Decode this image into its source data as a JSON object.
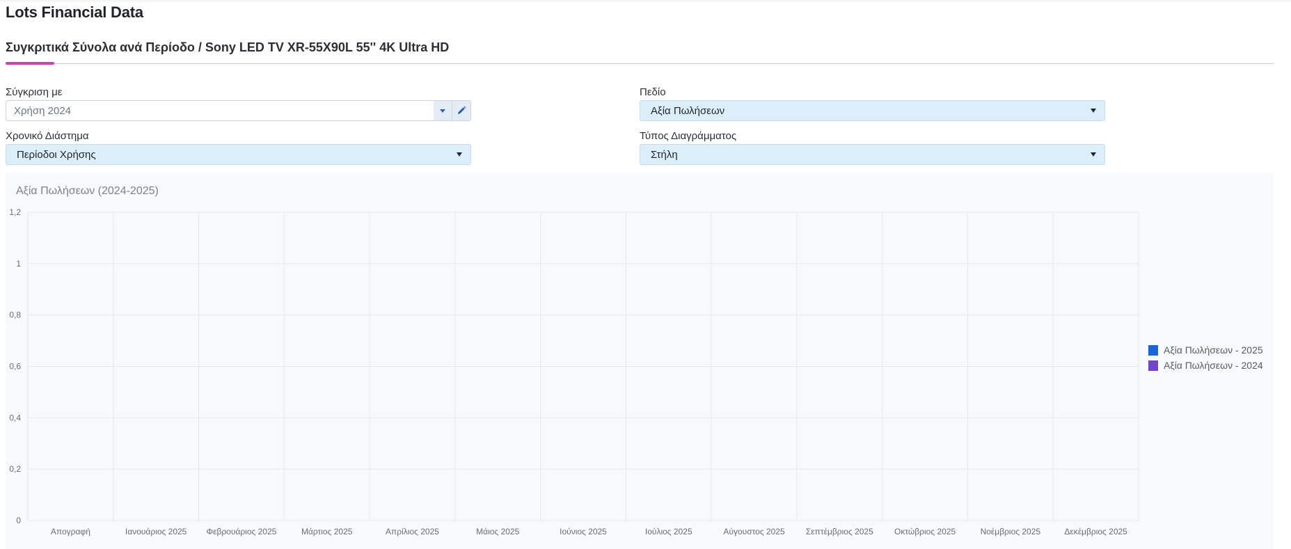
{
  "app": {
    "title": "Lots Financial Data"
  },
  "tab": {
    "title": "Συγκριτικά Σύνολα ανά Περίοδο / Sony LED TV XR-55X90L 55'' 4K Ultra HD"
  },
  "filters": {
    "compare_with": {
      "label": "Σύγκριση με",
      "value": "Χρήση 2024"
    },
    "field": {
      "label": "Πεδίο",
      "value": "Αξία Πωλήσεων"
    },
    "time_range": {
      "label": "Χρονικό Διάστημα",
      "value": "Περίοδοι Χρήσης"
    },
    "chart_type": {
      "label": "Τύπος Διαγράμματος",
      "value": "Στήλη"
    }
  },
  "colors": {
    "accent_tab": "#d63fae",
    "series_2025": "#1a66d9",
    "series_2024": "#6f46c9"
  },
  "chart_data": {
    "type": "bar",
    "title": "Αξία Πωλήσεων (2024-2025)",
    "categories": [
      "Απογραφή",
      "Ιανουάριος 2025",
      "Φεβρουάριος 2025",
      "Μάρτιος 2025",
      "Απρίλιος 2025",
      "Μάιος 2025",
      "Ιούνιος 2025",
      "Ιούλιος 2025",
      "Αύγουστος 2025",
      "Σεπτέμβριος 2025",
      "Οκτώβριος 2025",
      "Νοέμβριος 2025",
      "Δεκέμβριος 2025"
    ],
    "series": [
      {
        "name": "Αξία Πωλήσεων - 2025",
        "values": [
          0,
          0,
          0,
          0,
          0,
          0,
          0,
          0,
          0,
          0,
          0,
          0,
          0
        ]
      },
      {
        "name": "Αξία Πωλήσεων - 2024",
        "values": [
          0,
          0,
          0,
          0,
          0,
          0,
          0,
          0,
          0,
          0,
          0,
          0,
          0
        ]
      }
    ],
    "y_ticks": [
      "0",
      "0,2",
      "0,4",
      "0,6",
      "0,8",
      "1",
      "1,2"
    ],
    "ylim": [
      0,
      1.2
    ],
    "grid": true,
    "legend_position": "right"
  }
}
